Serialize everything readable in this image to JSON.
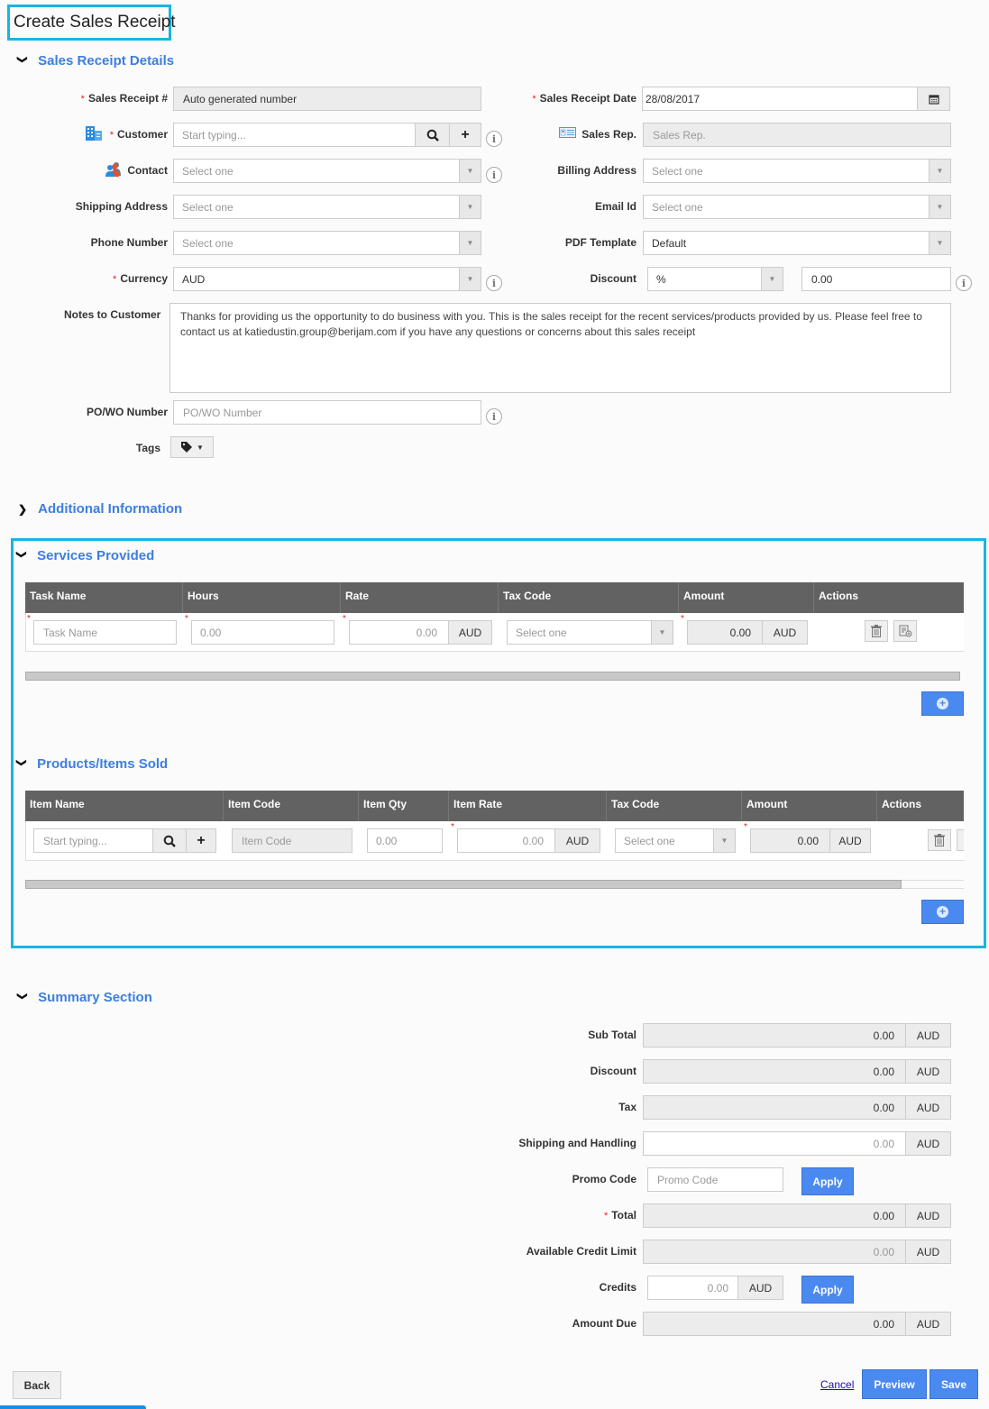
{
  "page": {
    "title": "Create Sales Receipt"
  },
  "sections": {
    "details": "Sales Receipt Details",
    "additional": "Additional Information",
    "services": "Services Provided",
    "products": "Products/Items Sold",
    "summary": "Summary Section"
  },
  "details": {
    "receipt_no": {
      "label": "Sales Receipt #",
      "value": "Auto generated number"
    },
    "customer": {
      "label": "Customer",
      "placeholder": "Start typing..."
    },
    "contact": {
      "label": "Contact",
      "value": "Select one"
    },
    "shipping_address": {
      "label": "Shipping Address",
      "value": "Select one"
    },
    "phone_number": {
      "label": "Phone Number",
      "value": "Select one"
    },
    "currency": {
      "label": "Currency",
      "value": "AUD"
    },
    "receipt_date": {
      "label": "Sales Receipt Date",
      "value": "28/08/2017"
    },
    "sales_rep": {
      "label": "Sales Rep.",
      "placeholder": "Sales Rep."
    },
    "billing_address": {
      "label": "Billing Address",
      "value": "Select one"
    },
    "email_id": {
      "label": "Email Id",
      "value": "Select one"
    },
    "pdf_template": {
      "label": "PDF Template",
      "value": "Default"
    },
    "discount": {
      "label": "Discount",
      "type_value": "%",
      "amount": "0.00"
    },
    "notes": {
      "label": "Notes to Customer",
      "value": "Thanks for providing us the opportunity to do business with you. This is the sales receipt for the recent services/products provided by us. Please feel free to contact us at katiedustin.group@berijam.com if you have any questions or concerns about this sales receipt"
    },
    "po_wo": {
      "label": "PO/WO Number",
      "placeholder": "PO/WO Number"
    },
    "tags": {
      "label": "Tags"
    }
  },
  "services": {
    "columns": [
      "Task Name",
      "Hours",
      "Rate",
      "Tax Code",
      "Amount",
      "Actions"
    ],
    "row": {
      "task_placeholder": "Task Name",
      "hours_placeholder": "0.00",
      "rate": "0.00",
      "rate_currency": "AUD",
      "tax_code": "Select one",
      "amount": "0.00",
      "amount_currency": "AUD"
    }
  },
  "products": {
    "columns": [
      "Item Name",
      "Item Code",
      "Item Qty",
      "Item Rate",
      "Tax Code",
      "Amount",
      "Actions"
    ],
    "row": {
      "item_placeholder": "Start typing...",
      "code_placeholder": "Item Code",
      "qty_placeholder": "0.00",
      "rate": "0.00",
      "rate_currency": "AUD",
      "tax_code": "Select one",
      "amount": "0.00",
      "amount_currency": "AUD"
    }
  },
  "summary": {
    "sub_total": {
      "label": "Sub Total",
      "value": "0.00",
      "currency": "AUD"
    },
    "discount": {
      "label": "Discount",
      "value": "0.00",
      "currency": "AUD"
    },
    "tax": {
      "label": "Tax",
      "value": "0.00",
      "currency": "AUD"
    },
    "shipping": {
      "label": "Shipping and Handling",
      "value": "0.00",
      "currency": "AUD"
    },
    "promo": {
      "label": "Promo Code",
      "placeholder": "Promo Code",
      "apply": "Apply"
    },
    "total": {
      "label": "Total",
      "value": "0.00",
      "currency": "AUD"
    },
    "credit_limit": {
      "label": "Available Credit Limit",
      "value": "0.00",
      "currency": "AUD"
    },
    "credits": {
      "label": "Credits",
      "value": "0.00",
      "currency": "AUD",
      "apply": "Apply"
    },
    "amount_due": {
      "label": "Amount Due",
      "value": "0.00",
      "currency": "AUD"
    }
  },
  "footer": {
    "back": "Back",
    "cancel": "Cancel",
    "preview": "Preview",
    "save": "Save"
  },
  "colors": {
    "accent": "#3c7ee0",
    "primary_button": "#4a8af0",
    "highlight_outline": "#16b5e4",
    "table_header": "#626262"
  }
}
